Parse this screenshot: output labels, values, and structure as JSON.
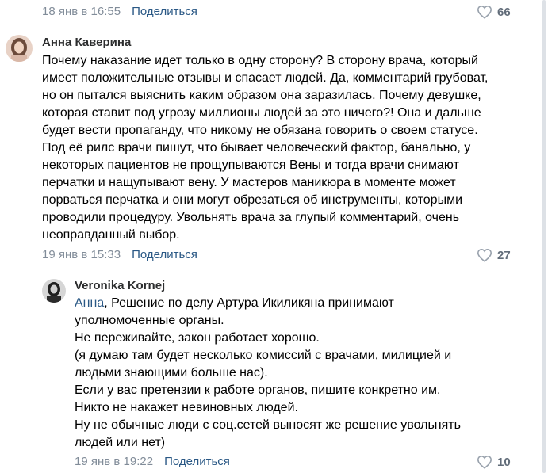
{
  "top_comment": {
    "date": "18 янв в 16:55",
    "share_label": "Поделиться",
    "likes": "66"
  },
  "comment1": {
    "author": "Анна Каверина",
    "lines": [
      "Почему наказание идет только в одну сторону? В сторону врача, который",
      "имеет положительные отзывы и спасает людей. Да, комментарий грубоват,",
      "но он пытался выяснить каким образом она заразилась. Почему девушке,",
      "которая ставит под угрозу миллионы людей за это ничего?! Она и дальше",
      "будет вести пропаганду, что никому не обязана говорить о своем статусе.",
      "Под её рилс врачи пишут, что бывает человеческий фактор, банально, у",
      "некоторых пациентов не прощупываются Вены и тогда врачи снимают",
      "перчатки и нащупывают вену. У мастеров маникюра в моменте может",
      "порваться перчатка и они могут обрезаться об инструменты, которыми",
      "проводили процедуру. Увольнять врача за глупый комментарий, очень",
      "неоправданный выбор."
    ],
    "date": "19 янв в 15:33",
    "share_label": "Поделиться",
    "likes": "27"
  },
  "reply1": {
    "author": "Veronika Kornej",
    "mention": "Анна",
    "first_line_rest": ", Решение по делу Артура Икиликяна принимают",
    "lines": [
      "уполномоченные органы.",
      "Не переживайте, закон работает хорошо.",
      "(я думаю там будет несколько комиссий с врачами, милицией и",
      "людьми знающими больше нас).",
      "Если у вас претензии к работе органов, пишите конкретно им.",
      "Никто не накажет невиновных людей.",
      "Ну не обычные люди с соц.сетей выносят же решение увольнять",
      "людей или нет)"
    ],
    "date": "19 янв в 19:22",
    "share_label": "Поделиться",
    "likes": "10"
  },
  "colors": {
    "link": "#2a5885",
    "meta": "#818c99",
    "like_icon": "#99a2ad"
  }
}
